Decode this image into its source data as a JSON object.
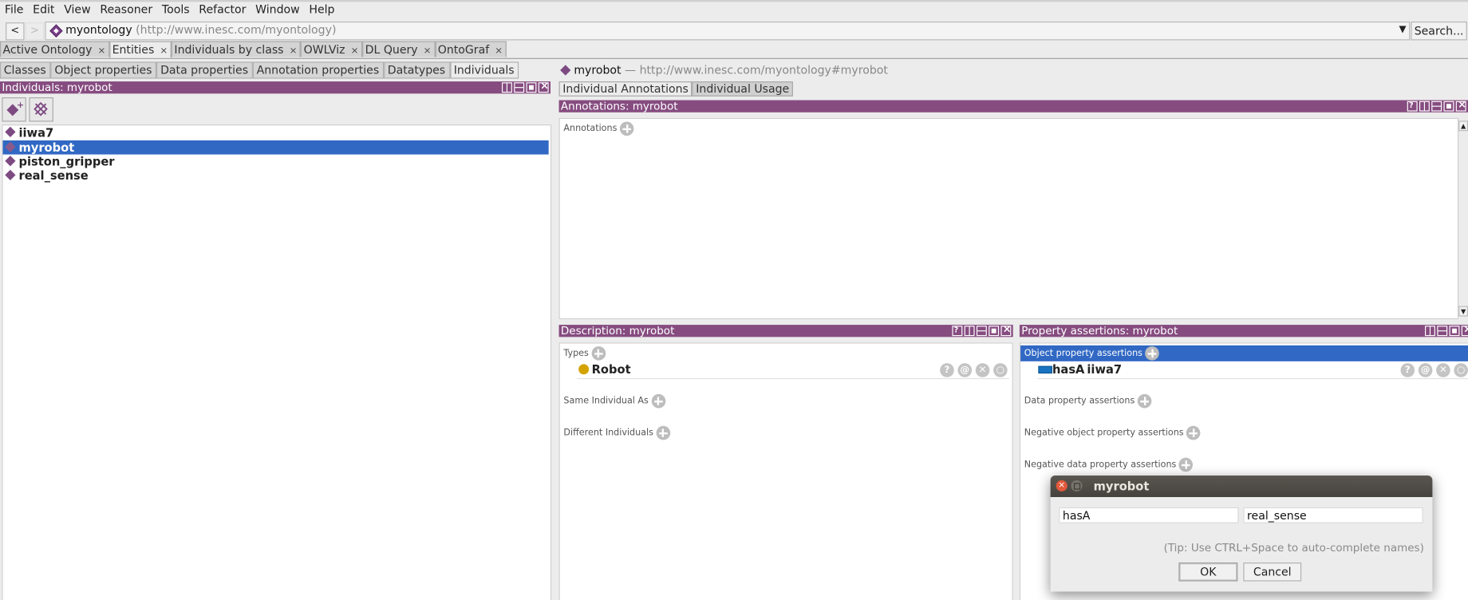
{
  "menubar": {
    "items": [
      "File",
      "Edit",
      "View",
      "Reasoner",
      "Tools",
      "Refactor",
      "Window",
      "Help"
    ]
  },
  "navbar": {
    "back_label": "<",
    "forward_label": ">",
    "ontology_name": "myontology",
    "ontology_iri": "(http://www.inesc.com/myontology)",
    "search_label": "Search..."
  },
  "workspace_tabs": [
    {
      "label": "Active Ontology",
      "active": false
    },
    {
      "label": "Entities",
      "active": true
    },
    {
      "label": "Individuals by class",
      "active": false
    },
    {
      "label": "OWLViz",
      "active": false
    },
    {
      "label": "DL Query",
      "active": false
    },
    {
      "label": "OntoGraf",
      "active": false
    }
  ],
  "entity_tabs": [
    "Classes",
    "Object properties",
    "Data properties",
    "Annotation properties",
    "Datatypes",
    "Individuals"
  ],
  "entity_tabs_active": "Individuals",
  "individuals_panel": {
    "title": "Individuals: myrobot",
    "items": [
      "iiwa7",
      "myrobot",
      "piston_gripper",
      "real_sense"
    ],
    "selected": "myrobot"
  },
  "entity_header": {
    "name": "myrobot",
    "separator": " — ",
    "iri": "http://www.inesc.com/myontology#myrobot"
  },
  "sub_tabs": [
    {
      "label": "Individual Annotations",
      "active": true
    },
    {
      "label": "Individual Usage",
      "active": false
    }
  ],
  "annotations_panel": {
    "title": "Annotations: myrobot",
    "section_label": "Annotations"
  },
  "description_panel": {
    "title": "Description: myrobot",
    "types_label": "Types",
    "types": [
      "Robot"
    ],
    "same_label": "Same Individual As",
    "different_label": "Different Individuals"
  },
  "property_panel": {
    "title": "Property assertions: myrobot",
    "object_label": "Object property assertions",
    "object_assertions": [
      {
        "property": "hasA",
        "value": "iiwa7"
      }
    ],
    "data_label": "Data property assertions",
    "neg_object_label": "Negative object property assertions",
    "neg_data_label": "Negative data property assertions"
  },
  "row_buttons": {
    "help": "?",
    "annotate": "@",
    "delete": "✕",
    "edit": "○"
  },
  "dialog": {
    "title": "myrobot",
    "property_value": "hasA",
    "individual_value": "real_sense",
    "tip": "(Tip: Use CTRL+Space to auto-complete names)",
    "ok_label": "OK",
    "cancel_label": "Cancel"
  },
  "colors": {
    "view_header": "#864c80",
    "selection": "#3068c4",
    "individual_icon": "#7d4a82",
    "class_icon": "#d4a300",
    "object_property_icon": "#1a73c0"
  }
}
